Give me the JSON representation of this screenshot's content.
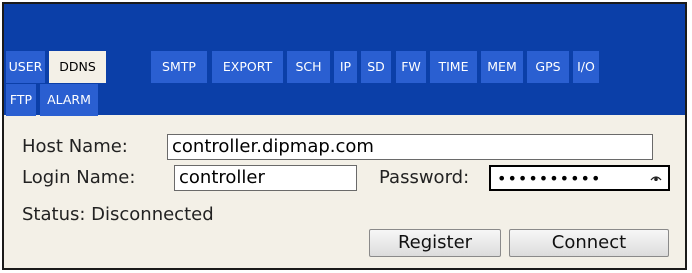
{
  "tabs": [
    {
      "label": "USER"
    },
    {
      "label": "DDNS"
    },
    {
      "label": "SMTP"
    },
    {
      "label": "EXPORT"
    },
    {
      "label": "SCH"
    },
    {
      "label": "IP"
    },
    {
      "label": "SD"
    },
    {
      "label": "FW"
    },
    {
      "label": "TIME"
    },
    {
      "label": "MEM"
    },
    {
      "label": "GPS"
    },
    {
      "label": "I/O"
    },
    {
      "label": "FTP"
    },
    {
      "label": "ALARM"
    }
  ],
  "active_tab": "DDNS",
  "form": {
    "host_label": "Host Name:",
    "host_value": "controller.dipmap.com",
    "login_label": "Login Name:",
    "login_value": "controller",
    "password_label": "Password:",
    "password_value": "••••••••••",
    "status_text": "Status: Disconnected"
  },
  "buttons": {
    "register": "Register",
    "connect": "Connect"
  },
  "colors": {
    "tabbar_bg": "#0b3fa8",
    "tab_bg": "#2a5fd1",
    "panel_bg": "#f3f0e7"
  }
}
